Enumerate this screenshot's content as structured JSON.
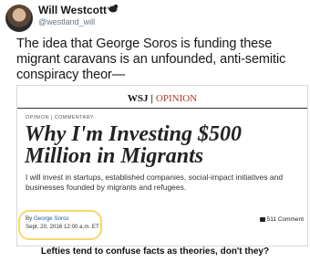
{
  "tweet": {
    "author": "Will Westcott",
    "handle": "@westland_will",
    "text": "The idea that George Soros is funding these migrant caravans is an unfounded, anti-semitic conspiracy theor—",
    "badge_icon": "bird-emoji-icon"
  },
  "article": {
    "masthead_brand": "WSJ",
    "masthead_separator": "|",
    "masthead_section": "OPINION",
    "section_label": "OPINION | COMMENTARY",
    "headline": "Why I'm Investing $500 Million in Migrants",
    "dek": "I will invest in startups, established companies, social-impact initiatives and businesses founded by migrants and refugees.",
    "byline_prefix": "By",
    "byline_author": "George Soros",
    "date": "Sept. 20, 2016 12:00 a.m. ET",
    "comments": "511 Comment",
    "highlight_color": "#f5d86a"
  },
  "caption": "Lefties tend to confuse facts as theories, don't they?"
}
